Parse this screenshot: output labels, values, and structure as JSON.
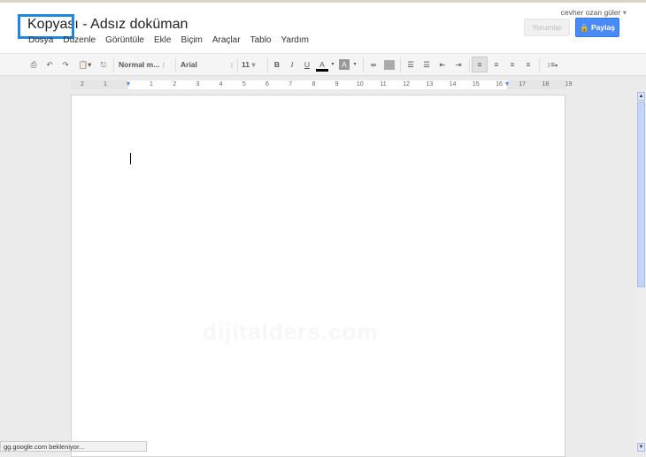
{
  "document": {
    "title": "Kopyası - Adsız doküman",
    "watermark": "dijitalders.com"
  },
  "menu": [
    "Dosya",
    "Düzenle",
    "Görüntüle",
    "Ekle",
    "Biçim",
    "Araçlar",
    "Tablo",
    "Yardım"
  ],
  "user": {
    "name": "cevher ozan güler"
  },
  "buttons": {
    "comments": "Yorumlar",
    "share": "Paylaş"
  },
  "toolbar": {
    "style": "Normal m...",
    "font": "Arial",
    "size": "11",
    "bold": "B",
    "italic": "I",
    "underline": "U",
    "text_color": "A"
  },
  "ruler": {
    "labels": [
      "2",
      "1",
      "1",
      "2",
      "3",
      "4",
      "5",
      "6",
      "7",
      "8",
      "9",
      "10",
      "11",
      "12",
      "13",
      "14",
      "15",
      "16",
      "17",
      "18",
      "19"
    ]
  },
  "status": "gg.google.com bekleniyor...",
  "colors": {
    "accent": "#4a8af4",
    "highlight": "#1e88e5"
  }
}
